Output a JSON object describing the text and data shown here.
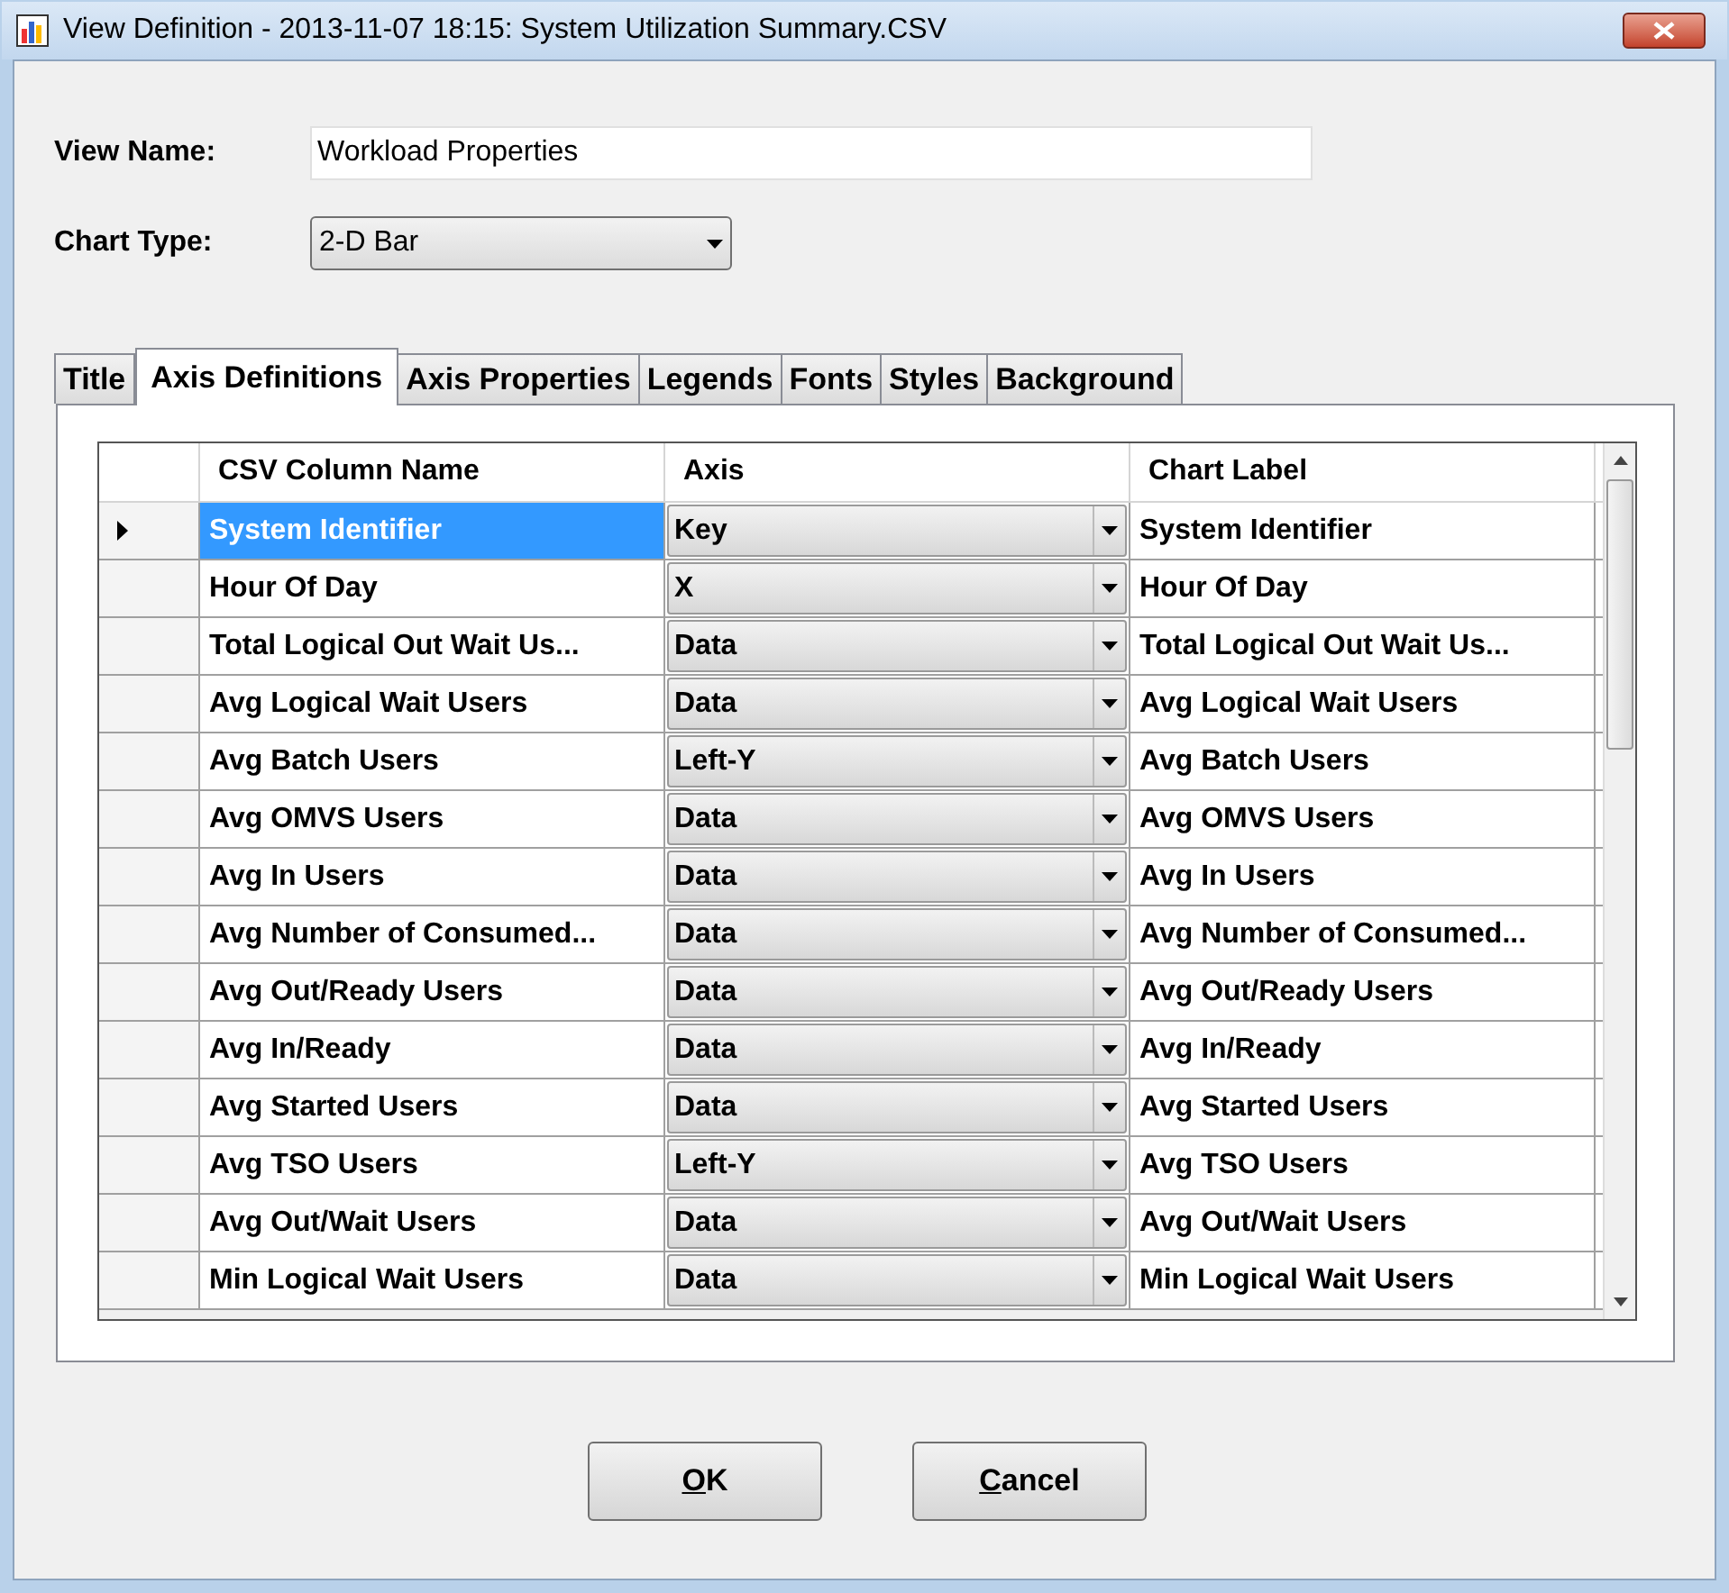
{
  "window": {
    "title": "View Definition - 2013-11-07 18:15: System Utilization Summary.CSV"
  },
  "view_name": {
    "label": "View Name:",
    "value": "Workload Properties"
  },
  "chart_type": {
    "label": "Chart Type:",
    "value": "2-D Bar"
  },
  "tabs": [
    {
      "label": "Title",
      "selected": false
    },
    {
      "label": "Axis Definitions",
      "selected": true
    },
    {
      "label": "Axis Properties",
      "selected": false
    },
    {
      "label": "Legends",
      "selected": false
    },
    {
      "label": "Fonts",
      "selected": false
    },
    {
      "label": "Styles",
      "selected": false
    },
    {
      "label": "Background",
      "selected": false
    }
  ],
  "table": {
    "columns": [
      "CSV Column Name",
      "Axis",
      "Chart Label"
    ],
    "rows": [
      {
        "csv": "System Identifier",
        "axis": "Key",
        "label": "System Identifier",
        "selected": true
      },
      {
        "csv": "Hour Of Day",
        "axis": "X",
        "label": "Hour Of Day",
        "selected": false
      },
      {
        "csv": "Total Logical Out Wait Us...",
        "axis": "Data",
        "label": "Total Logical Out Wait Us...",
        "selected": false
      },
      {
        "csv": "Avg Logical Wait Users",
        "axis": "Data",
        "label": "Avg Logical Wait Users",
        "selected": false
      },
      {
        "csv": "Avg Batch Users",
        "axis": "Left-Y",
        "label": "Avg Batch Users",
        "selected": false
      },
      {
        "csv": "Avg OMVS Users",
        "axis": "Data",
        "label": "Avg OMVS Users",
        "selected": false
      },
      {
        "csv": "Avg In Users",
        "axis": "Data",
        "label": "Avg In Users",
        "selected": false
      },
      {
        "csv": "Avg Number of Consumed...",
        "axis": "Data",
        "label": "Avg Number of Consumed...",
        "selected": false
      },
      {
        "csv": "Avg Out/Ready Users",
        "axis": "Data",
        "label": "Avg Out/Ready Users",
        "selected": false
      },
      {
        "csv": "Avg In/Ready",
        "axis": "Data",
        "label": "Avg In/Ready",
        "selected": false
      },
      {
        "csv": "Avg Started Users",
        "axis": "Data",
        "label": "Avg Started Users",
        "selected": false
      },
      {
        "csv": "Avg TSO Users",
        "axis": "Left-Y",
        "label": "Avg TSO Users",
        "selected": false
      },
      {
        "csv": "Avg Out/Wait Users",
        "axis": "Data",
        "label": "Avg Out/Wait Users",
        "selected": false
      },
      {
        "csv": "Min Logical Wait Users",
        "axis": "Data",
        "label": "Min Logical Wait Users",
        "selected": false
      }
    ]
  },
  "buttons": [
    "OK",
    "Cancel"
  ]
}
